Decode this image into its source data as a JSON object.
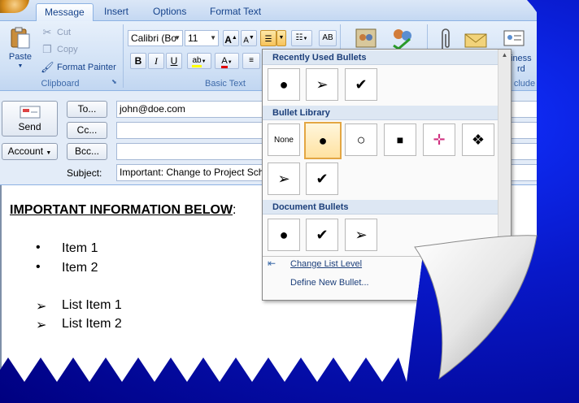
{
  "tabs": [
    "Message",
    "Insert",
    "Options",
    "Format Text"
  ],
  "clipboard": {
    "paste": "Paste",
    "cut": "Cut",
    "copy": "Copy",
    "format_painter": "Format Painter",
    "group_label": "Clipboard"
  },
  "basic_text": {
    "font_name": "Calibri (Bo",
    "font_size": "11",
    "bold": "B",
    "italic": "I",
    "underline": "U",
    "group_label": "Basic Text"
  },
  "include": {
    "business_card_label": "iness",
    "business_card_label2": "rd",
    "group_label": "clude"
  },
  "header": {
    "send": "Send",
    "to": "To...",
    "cc": "Cc...",
    "bcc": "Bcc...",
    "account": "Account",
    "subject_label": "Subject:",
    "to_value": "john@doe.com",
    "cc_value": "",
    "bcc_value": "",
    "subject_value": "Important:  Change to Project Sche"
  },
  "body": {
    "heading": "IMPORTANT INFORMATION BELOW",
    "heading_colon": ":",
    "bullet_items": [
      "Item 1",
      "Item 2"
    ],
    "arrow_items": [
      "List Item 1",
      "List Item 2"
    ]
  },
  "gallery": {
    "recently_used": "Recently Used Bullets",
    "library": "Bullet Library",
    "document": "Document Bullets",
    "none_label": "None",
    "change_level": "Change List Level",
    "define_new": "Define New Bullet..."
  }
}
